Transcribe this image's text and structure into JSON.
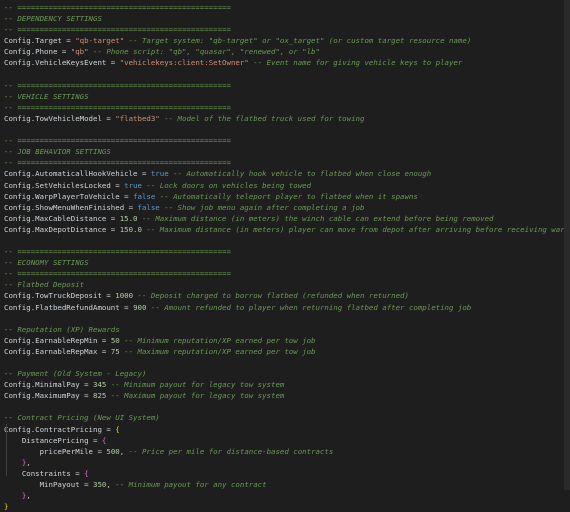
{
  "theme": {
    "background": "#1e1e1e",
    "comment": "#6a9955",
    "string": "#ce9178",
    "number": "#b5cea8",
    "keyword": "#569cd6",
    "text": "#d4d4d4"
  },
  "code_lines": [
    [
      {
        "t": "c",
        "v": "-- ================================================"
      }
    ],
    [
      {
        "t": "c",
        "v": "-- DEPENDENCY SETTINGS"
      }
    ],
    [
      {
        "t": "c",
        "v": "-- ================================================"
      }
    ],
    [
      {
        "t": "v",
        "v": "Config.Target"
      },
      {
        "t": "p",
        "v": " = "
      },
      {
        "t": "s",
        "v": "\"qb-target\""
      },
      {
        "t": "c",
        "v": " -- Target system: \"qb-target\" or \"ox_target\" (or custom target resource name)"
      }
    ],
    [
      {
        "t": "v",
        "v": "Config.Phone"
      },
      {
        "t": "p",
        "v": " = "
      },
      {
        "t": "s",
        "v": "\"qb\""
      },
      {
        "t": "c",
        "v": " -- Phone script: \"qb\", \"quasar\", \"renewed\", or \"lb\""
      }
    ],
    [
      {
        "t": "v",
        "v": "Config.VehicleKeysEvent"
      },
      {
        "t": "p",
        "v": " = "
      },
      {
        "t": "s",
        "v": "\"vehiclekeys:client:SetOwner\""
      },
      {
        "t": "c",
        "v": " -- Event name for giving vehicle keys to player"
      }
    ],
    [],
    [
      {
        "t": "c",
        "v": "-- ================================================"
      }
    ],
    [
      {
        "t": "c",
        "v": "-- VEHICLE SETTINGS"
      }
    ],
    [
      {
        "t": "c",
        "v": "-- ================================================"
      }
    ],
    [
      {
        "t": "v",
        "v": "Config.TowVehicleModel"
      },
      {
        "t": "p",
        "v": " = "
      },
      {
        "t": "s",
        "v": "\"flatbed3\""
      },
      {
        "t": "c",
        "v": " -- Model of the flatbed truck used for towing"
      }
    ],
    [],
    [
      {
        "t": "c",
        "v": "-- ================================================"
      }
    ],
    [
      {
        "t": "c",
        "v": "-- JOB BEHAVIOR SETTINGS"
      }
    ],
    [
      {
        "t": "c",
        "v": "-- ================================================"
      }
    ],
    [
      {
        "t": "v",
        "v": "Config.AutomaticallHookVehicle"
      },
      {
        "t": "p",
        "v": " = "
      },
      {
        "t": "k",
        "v": "true"
      },
      {
        "t": "c",
        "v": " -- Automatically hook vehicle to flatbed when close enough"
      }
    ],
    [
      {
        "t": "v",
        "v": "Config.SetVehiclesLocked"
      },
      {
        "t": "p",
        "v": " = "
      },
      {
        "t": "k",
        "v": "true"
      },
      {
        "t": "c",
        "v": " -- Lock doors on vehicles being towed"
      }
    ],
    [
      {
        "t": "v",
        "v": "Config.WarpPlayerToVehicle"
      },
      {
        "t": "p",
        "v": " = "
      },
      {
        "t": "k",
        "v": "false"
      },
      {
        "t": "c",
        "v": " -- Automatically teleport player to flatbed when it spawns"
      }
    ],
    [
      {
        "t": "v",
        "v": "Config.ShowMenuWhenFinished"
      },
      {
        "t": "p",
        "v": " = "
      },
      {
        "t": "k",
        "v": "false"
      },
      {
        "t": "c",
        "v": " -- Show job menu again after completing a job"
      }
    ],
    [
      {
        "t": "v",
        "v": "Config.MaxCableDistance"
      },
      {
        "t": "p",
        "v": " = "
      },
      {
        "t": "n",
        "v": "15.0"
      },
      {
        "t": "c",
        "v": " -- Maximum distance (in meters) the winch cable can extend before being removed"
      }
    ],
    [
      {
        "t": "v",
        "v": "Config.MaxDepotDistance"
      },
      {
        "t": "p",
        "v": " = "
      },
      {
        "t": "n",
        "v": "150.0"
      },
      {
        "t": "c",
        "v": " -- Maximum distance (in meters) player can move from depot after arriving before receiving warning"
      }
    ],
    [],
    [
      {
        "t": "c",
        "v": "-- ================================================"
      }
    ],
    [
      {
        "t": "c",
        "v": "-- ECONOMY SETTINGS"
      }
    ],
    [
      {
        "t": "c",
        "v": "-- ================================================"
      }
    ],
    [
      {
        "t": "c",
        "v": "-- Flatbed Deposit"
      }
    ],
    [
      {
        "t": "v",
        "v": "Config.TowTruckDeposit"
      },
      {
        "t": "p",
        "v": " = "
      },
      {
        "t": "n",
        "v": "1000"
      },
      {
        "t": "c",
        "v": " -- Deposit charged to borrow flatbed (refunded when returned)"
      }
    ],
    [
      {
        "t": "v",
        "v": "Config.FlatbedRefundAmount"
      },
      {
        "t": "p",
        "v": " = "
      },
      {
        "t": "n",
        "v": "900"
      },
      {
        "t": "c",
        "v": " -- Amount refunded to player when returning flatbed after completing job"
      }
    ],
    [],
    [
      {
        "t": "c",
        "v": "-- Reputation (XP) Rewards"
      }
    ],
    [
      {
        "t": "v",
        "v": "Config.EarnableRepMin"
      },
      {
        "t": "p",
        "v": " = "
      },
      {
        "t": "n",
        "v": "50"
      },
      {
        "t": "c",
        "v": " -- Minimum reputation/XP earned per tow job"
      }
    ],
    [
      {
        "t": "v",
        "v": "Config.EarnableRepMax"
      },
      {
        "t": "p",
        "v": " = "
      },
      {
        "t": "n",
        "v": "75"
      },
      {
        "t": "c",
        "v": " -- Maximum reputation/XP earned per tow job"
      }
    ],
    [],
    [
      {
        "t": "c",
        "v": "-- Payment (Old System - Legacy)"
      }
    ],
    [
      {
        "t": "v",
        "v": "Config.MinimalPay"
      },
      {
        "t": "p",
        "v": " = "
      },
      {
        "t": "n",
        "v": "345"
      },
      {
        "t": "c",
        "v": " -- Minimum payout for legacy tow system"
      }
    ],
    [
      {
        "t": "v",
        "v": "Config.MaximumPay"
      },
      {
        "t": "p",
        "v": " = "
      },
      {
        "t": "n",
        "v": "825"
      },
      {
        "t": "c",
        "v": " -- Maximum payout for legacy tow system"
      }
    ],
    [],
    [
      {
        "t": "c",
        "v": "-- Contract Pricing (New UI System)"
      }
    ],
    [
      {
        "t": "v",
        "v": "Config.ContractPricing"
      },
      {
        "t": "p",
        "v": " = "
      },
      {
        "t": "b1",
        "v": "{"
      }
    ],
    [
      {
        "t": "p",
        "v": "    "
      },
      {
        "t": "v",
        "v": "DistancePricing"
      },
      {
        "t": "p",
        "v": " = "
      },
      {
        "t": "b2",
        "v": "{"
      }
    ],
    [
      {
        "t": "p",
        "v": "        "
      },
      {
        "t": "v",
        "v": "pricePerMile"
      },
      {
        "t": "p",
        "v": " = "
      },
      {
        "t": "n",
        "v": "500"
      },
      {
        "t": "p",
        "v": ","
      },
      {
        "t": "c",
        "v": " -- Price per mile for distance-based contracts"
      }
    ],
    [
      {
        "t": "p",
        "v": "    "
      },
      {
        "t": "b2",
        "v": "}"
      },
      {
        "t": "p",
        "v": ","
      }
    ],
    [
      {
        "t": "p",
        "v": "    "
      },
      {
        "t": "v",
        "v": "Constraints"
      },
      {
        "t": "p",
        "v": " = "
      },
      {
        "t": "b2",
        "v": "{"
      }
    ],
    [
      {
        "t": "p",
        "v": "        "
      },
      {
        "t": "v",
        "v": "MinPayout"
      },
      {
        "t": "p",
        "v": " = "
      },
      {
        "t": "n",
        "v": "350"
      },
      {
        "t": "p",
        "v": ","
      },
      {
        "t": "c",
        "v": " -- Minimum payout for any contract"
      }
    ],
    [
      {
        "t": "p",
        "v": "    "
      },
      {
        "t": "b2",
        "v": "}"
      },
      {
        "t": "p",
        "v": ","
      }
    ],
    [
      {
        "t": "b1",
        "v": "}"
      }
    ]
  ]
}
